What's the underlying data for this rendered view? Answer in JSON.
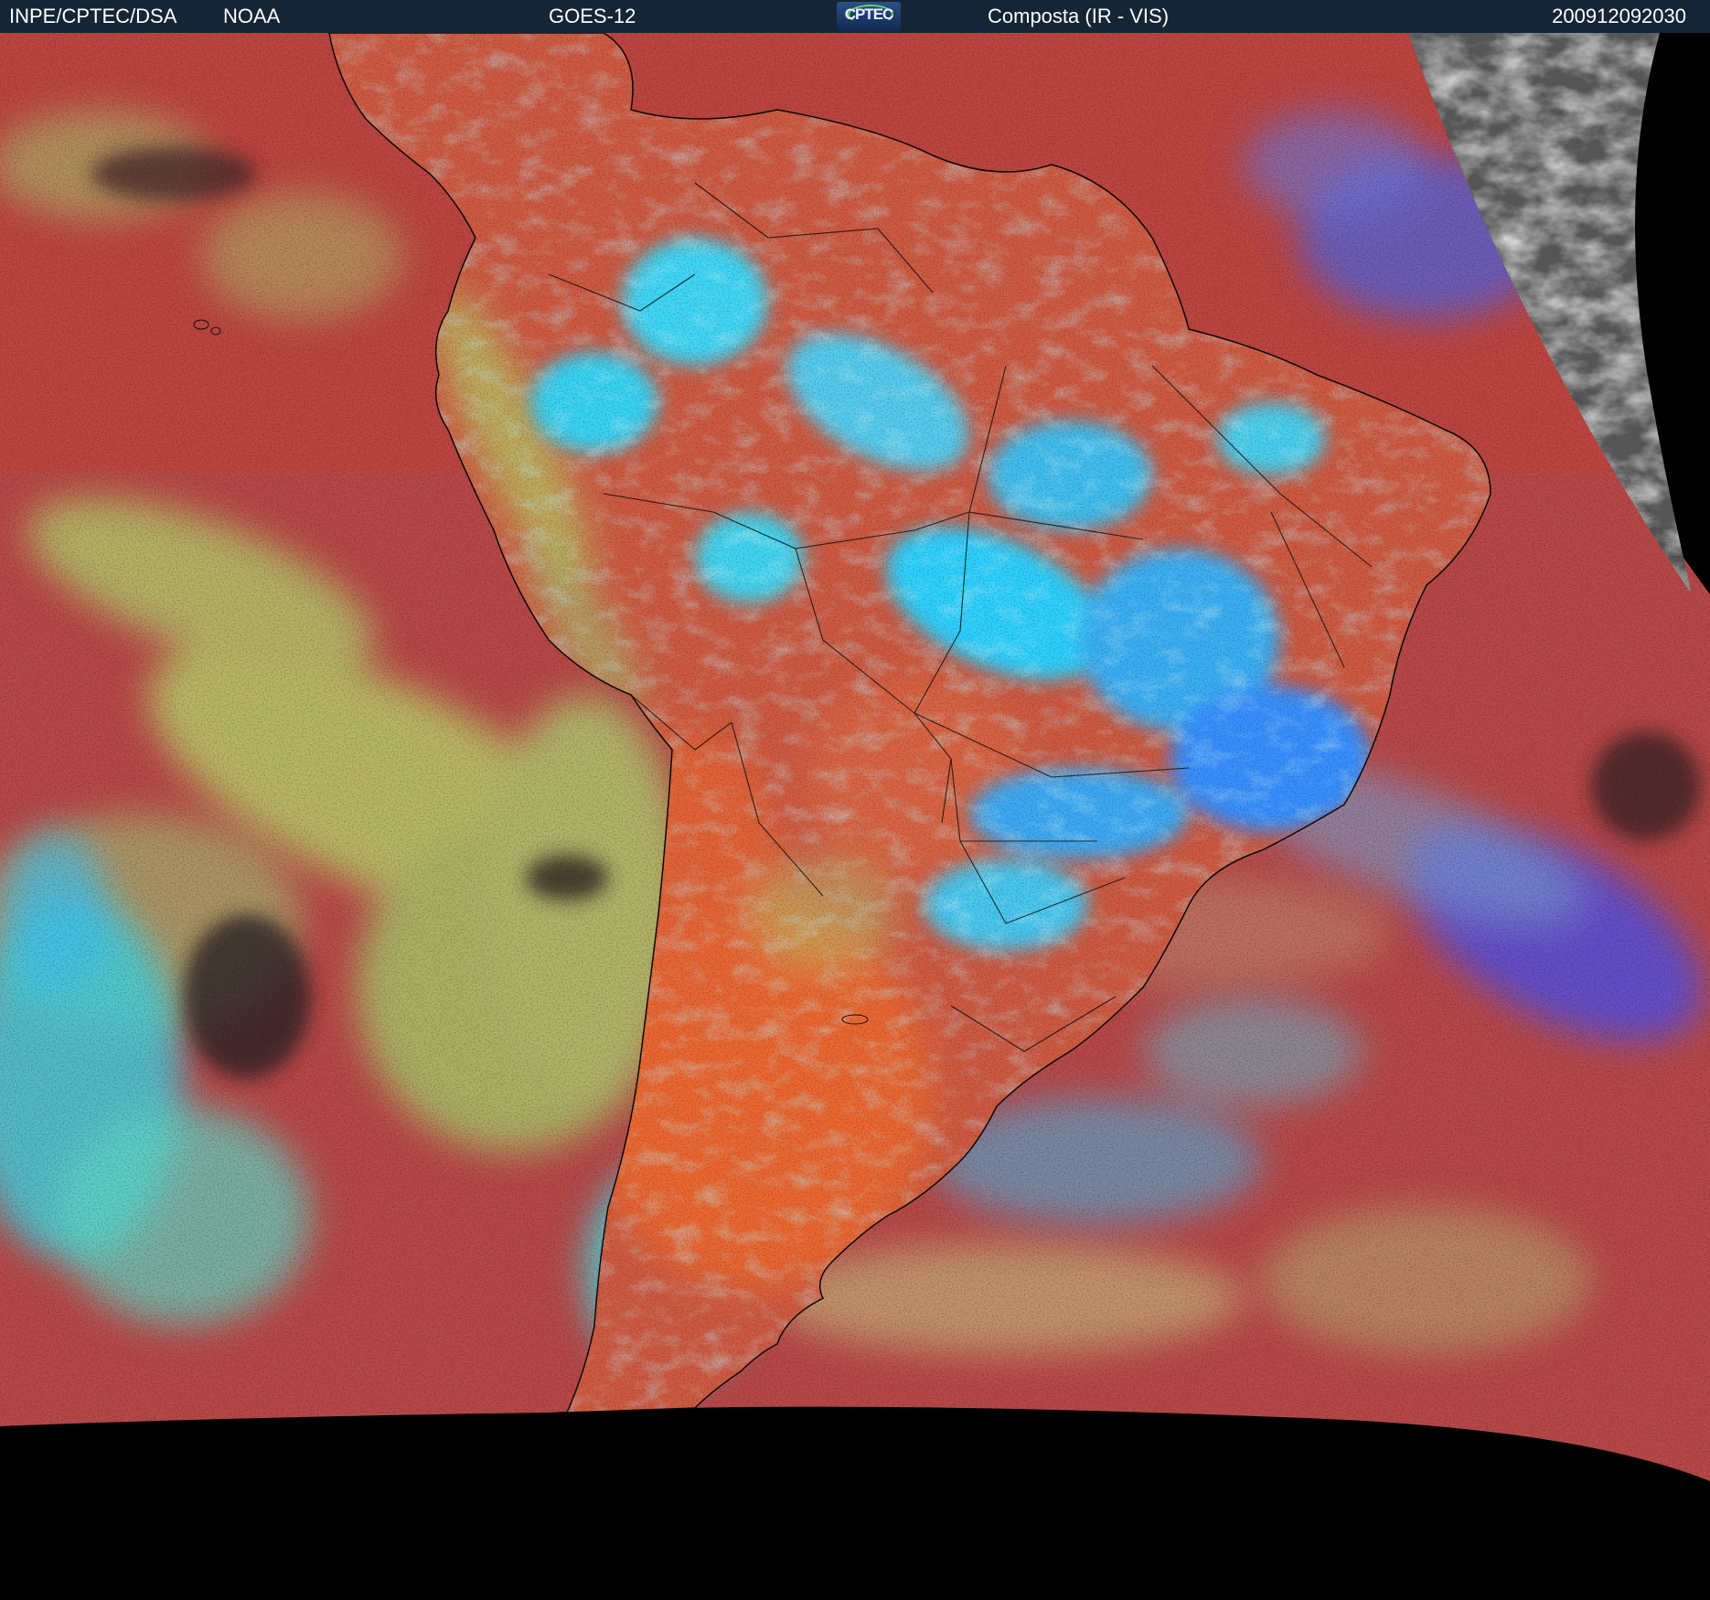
{
  "header": {
    "organization": "INPE/CPTEC/DSA",
    "agency": "NOAA",
    "satellite": "GOES-12",
    "logo_text": "CPTEC",
    "product": "Composta (IR - VIS)",
    "timestamp": "200912092030"
  },
  "colors": {
    "header_background": "#152535",
    "header_text": "#ffffff",
    "clear_ocean": "#b84848",
    "clear_land": "#e0603a",
    "high_cloud": "#40dcf6",
    "mid_cloud": "#3f86ff",
    "low_cloud": "#b9dc6c",
    "space": "#000000",
    "visible_channel_gray": "#6e6e6e",
    "coastline": "#0a0a0a"
  },
  "icons": {
    "logo": "cptec-logo-icon"
  }
}
